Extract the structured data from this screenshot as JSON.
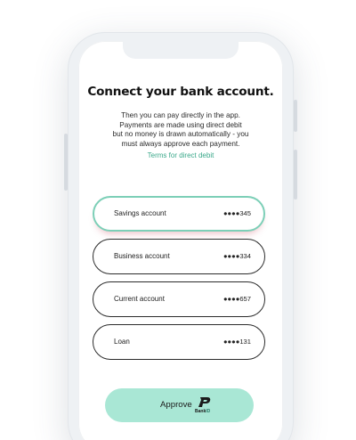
{
  "screen": {
    "heading": "Connect your bank account.",
    "description_lines": [
      "Then you can pay directly in the app.",
      "Payments are made using direct debit",
      "but no money is drawn automatically - you",
      "must always approve each payment."
    ],
    "terms_link": "Terms for direct debit"
  },
  "accounts": [
    {
      "name": "Savings account",
      "number": "●●●●345",
      "selected": true
    },
    {
      "name": "Business account",
      "number": "●●●●334",
      "selected": false
    },
    {
      "name": "Current account",
      "number": "●●●●657",
      "selected": false
    },
    {
      "name": "Loan",
      "number": "●●●●131",
      "selected": false
    }
  ],
  "approve": {
    "label": "Approve",
    "logo_text": "Bank",
    "logo_text_accent": "ID"
  },
  "colors": {
    "accent": "#3aa88a",
    "button_fill": "#a9e7d5",
    "selected_border": "#7ccfb7",
    "selected_shadow": "#c8465a",
    "phone_frame": "#eef1f4"
  },
  "icons": {
    "bankid": "bankid-logo-icon"
  }
}
